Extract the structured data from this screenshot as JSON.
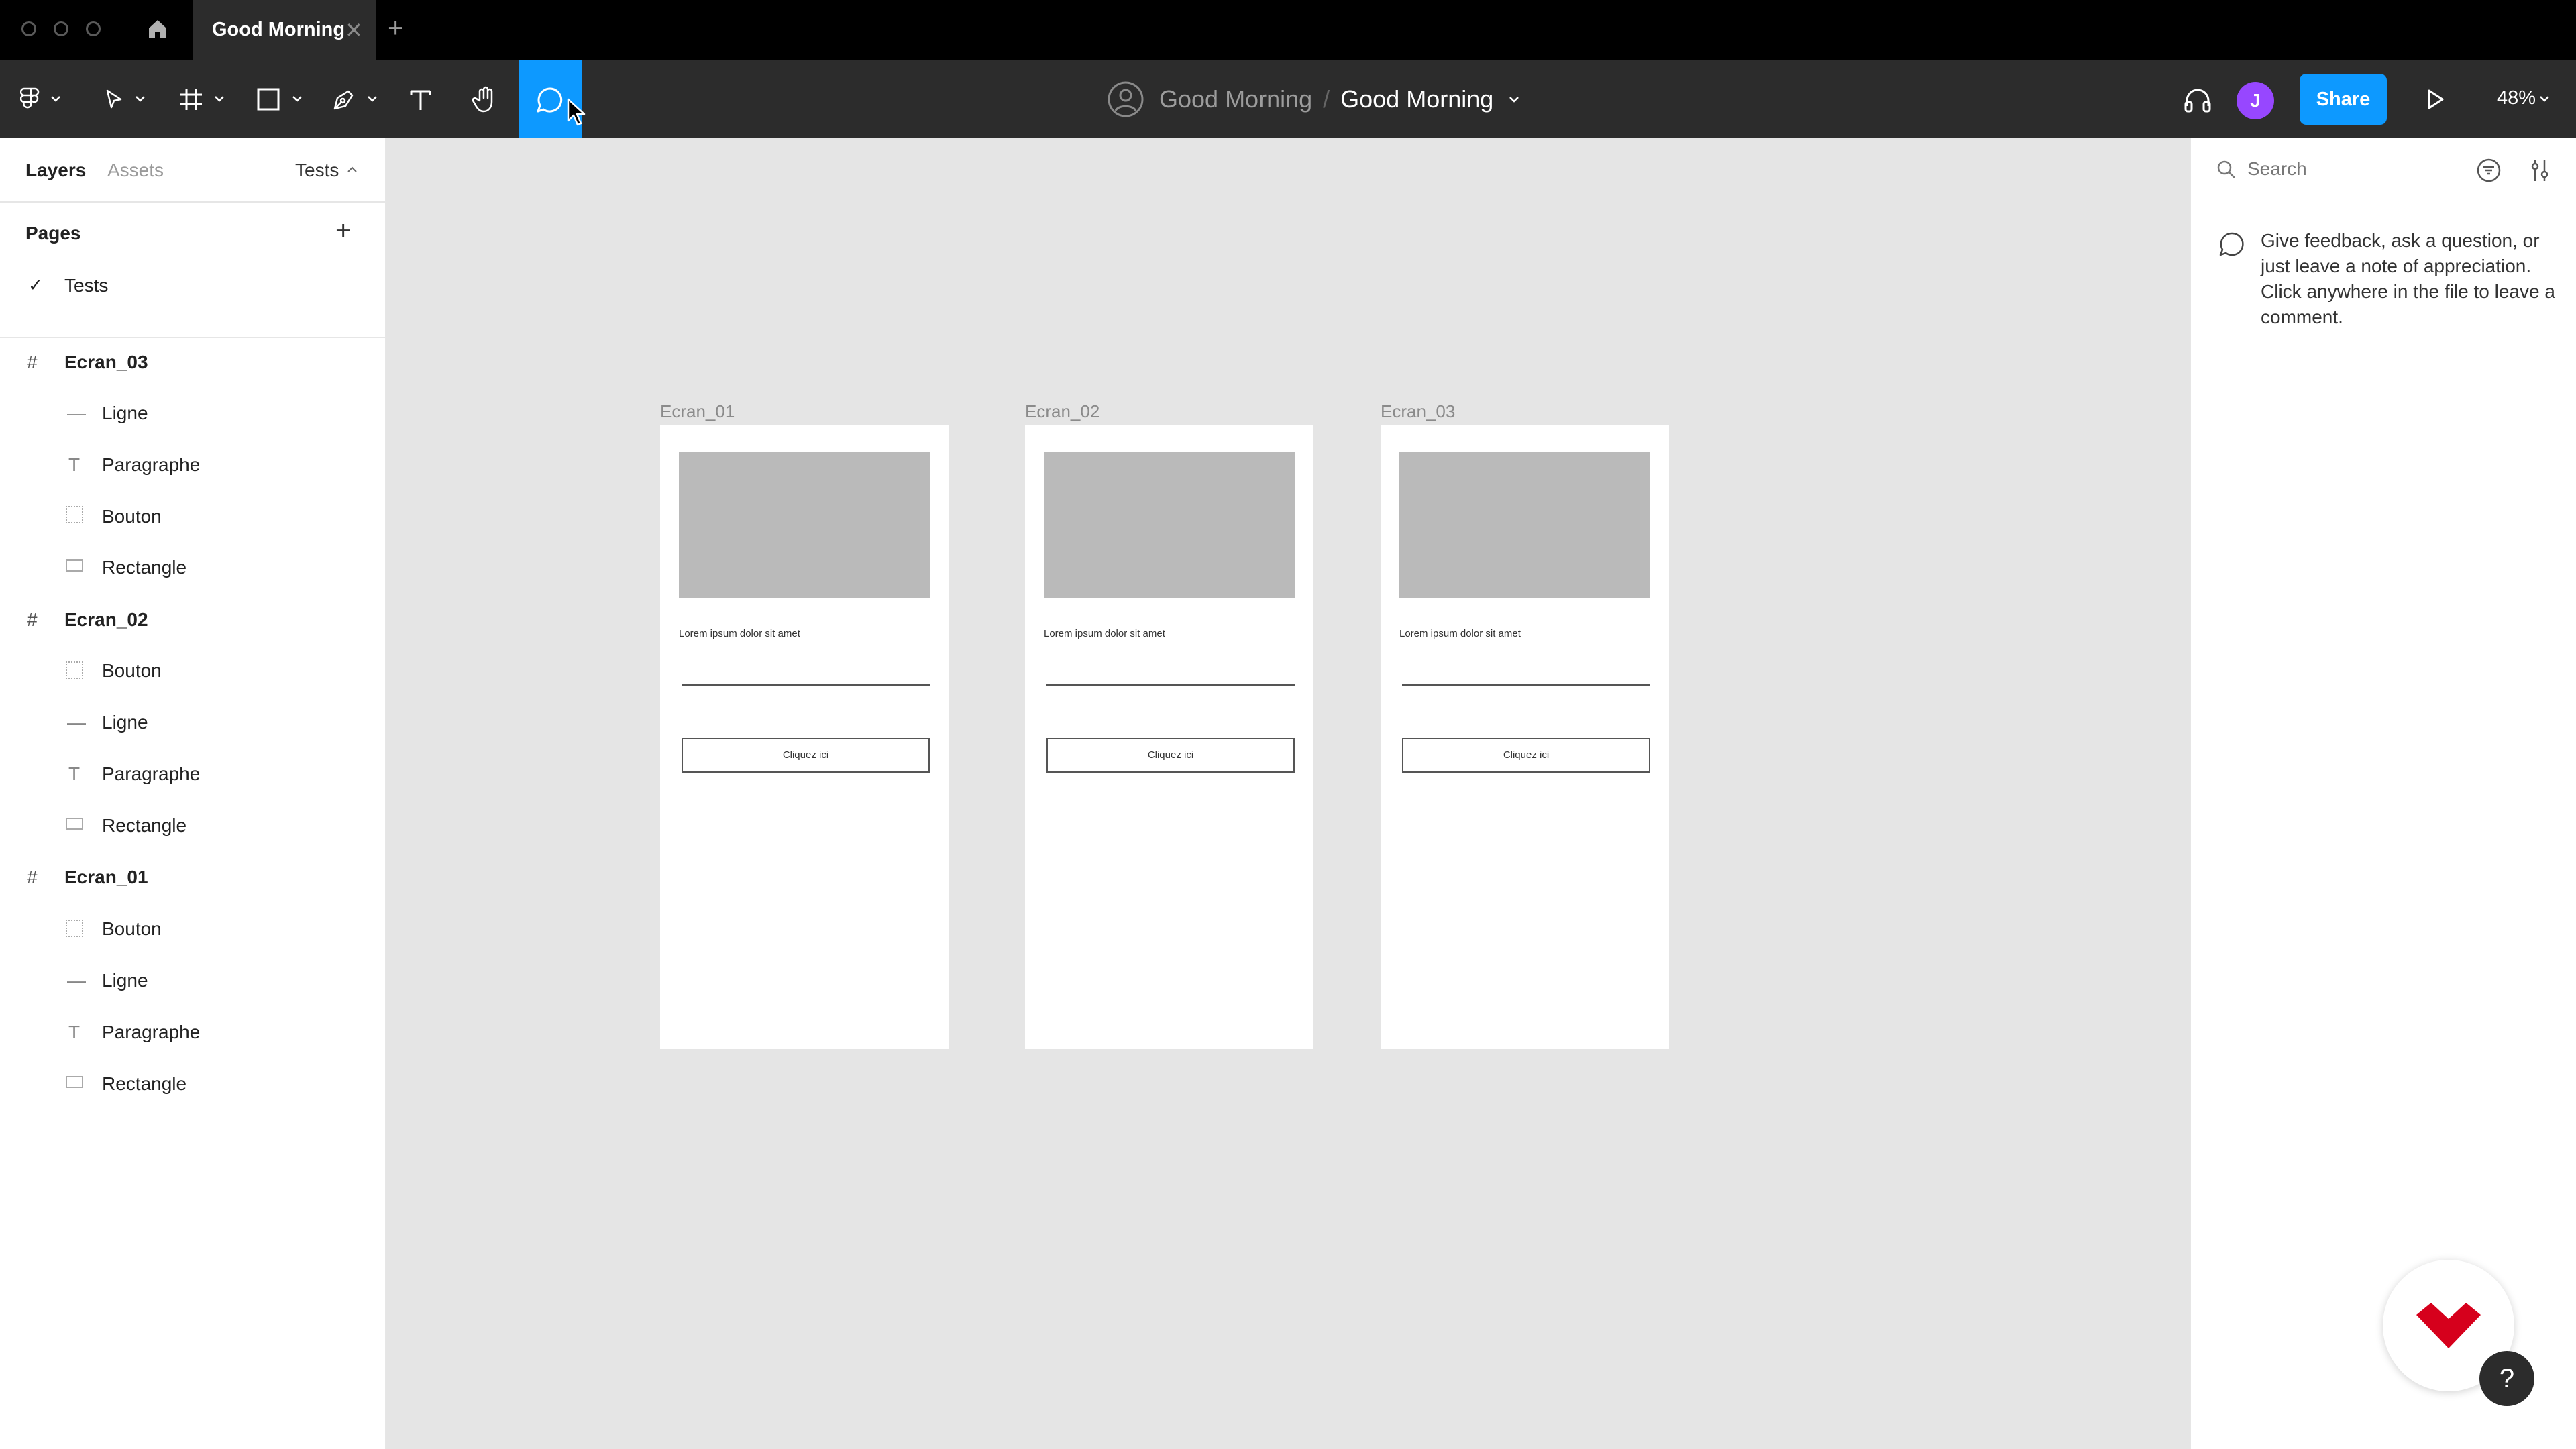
{
  "tabbar": {
    "file_tab_title": "Good Morning",
    "close_glyph": "✕",
    "new_tab_glyph": "+"
  },
  "toolbar": {
    "project_name": "Good Morning",
    "separator": "/",
    "file_name": "Good Morning",
    "avatar_initial": "J",
    "share_label": "Share",
    "zoom_label": "48%",
    "accent_color": "#0d99ff",
    "avatar_color": "#9747ff"
  },
  "left_panel": {
    "tabs": [
      {
        "label": "Layers"
      },
      {
        "label": "Assets"
      }
    ],
    "page_selector": "Tests",
    "pages_heading": "Pages",
    "add_glyph": "+",
    "pages": [
      {
        "label": "Tests",
        "checked": true
      }
    ],
    "layers": [
      {
        "label": "Ecran_03",
        "type": "frame",
        "children": [
          {
            "label": "Ligne",
            "icon": "line-icon"
          },
          {
            "label": "Paragraphe",
            "icon": "text-icon"
          },
          {
            "label": "Bouton",
            "icon": "component-icon"
          },
          {
            "label": "Rectangle",
            "icon": "rectangle-icon"
          }
        ]
      },
      {
        "label": "Ecran_02",
        "type": "frame",
        "children": [
          {
            "label": "Bouton",
            "icon": "component-icon"
          },
          {
            "label": "Ligne",
            "icon": "line-icon"
          },
          {
            "label": "Paragraphe",
            "icon": "text-icon"
          },
          {
            "label": "Rectangle",
            "icon": "rectangle-icon"
          }
        ]
      },
      {
        "label": "Ecran_01",
        "type": "frame",
        "children": [
          {
            "label": "Bouton",
            "icon": "component-icon"
          },
          {
            "label": "Ligne",
            "icon": "line-icon"
          },
          {
            "label": "Paragraphe",
            "icon": "text-icon"
          },
          {
            "label": "Rectangle",
            "icon": "rectangle-icon"
          }
        ]
      }
    ]
  },
  "canvas": {
    "frames": [
      {
        "label": "Ecran_01",
        "paragraph": "Lorem ipsum dolor sit amet",
        "button": "Cliquez ici"
      },
      {
        "label": "Ecran_02",
        "paragraph": "Lorem ipsum dolor sit amet",
        "button": "Cliquez ici"
      },
      {
        "label": "Ecran_03",
        "paragraph": "Lorem ipsum dolor sit amet",
        "button": "Cliquez ici"
      }
    ]
  },
  "right_panel": {
    "search_placeholder": "Search",
    "help_text": "Give feedback, ask a question, or just leave a note of appreciation. Click anywhere in the file to leave a comment."
  },
  "help_button_glyph": "?"
}
